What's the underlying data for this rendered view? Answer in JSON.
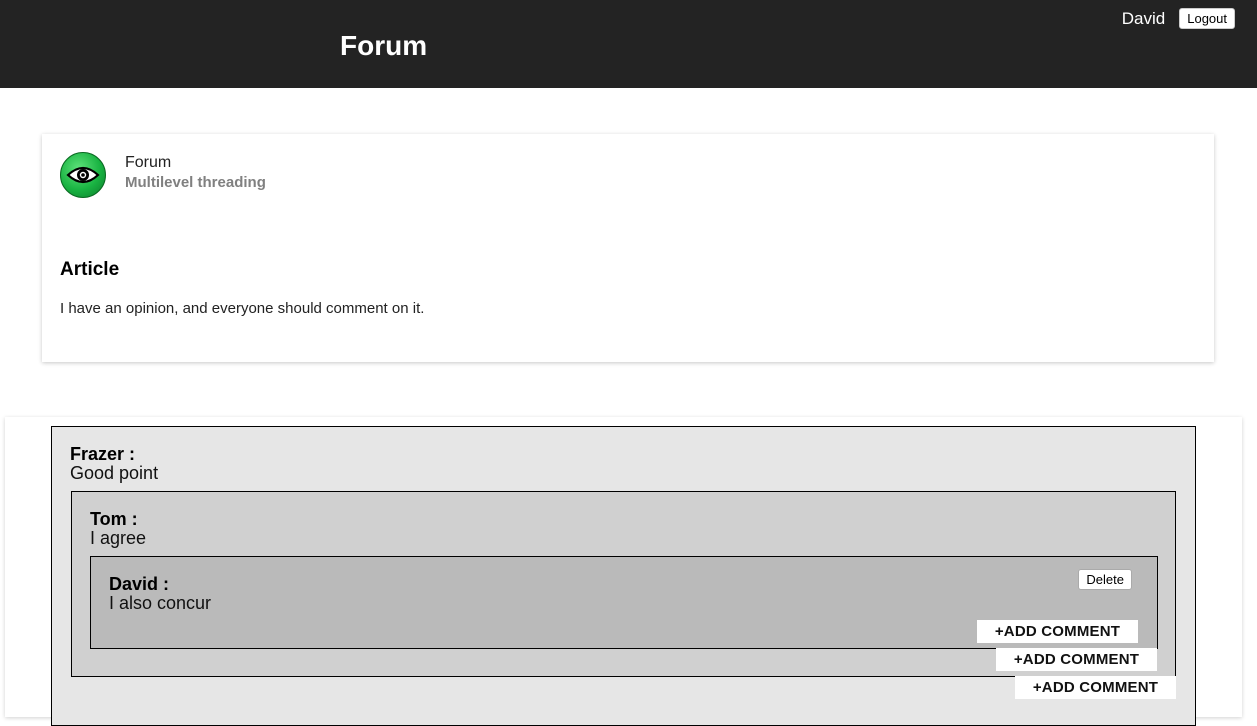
{
  "header": {
    "title": "Forum",
    "username": "David",
    "logout_label": "Logout"
  },
  "article": {
    "forum_name": "Forum",
    "forum_subtitle": "Multilevel threading",
    "heading": "Article",
    "body": "I have an opinion, and everyone should comment on it."
  },
  "comments": [
    {
      "author": "Frazer :",
      "text": "Good point",
      "add_label": "+ADD COMMENT",
      "replies": [
        {
          "author": "Tom :",
          "text": "I agree",
          "add_label": "+ADD COMMENT",
          "replies": [
            {
              "author": "David :",
              "text": "I also concur",
              "delete_label": "Delete",
              "add_label": "+ADD COMMENT"
            }
          ]
        }
      ]
    }
  ],
  "colors": {
    "header_bg": "#232323",
    "level1_bg": "#e6e6e6",
    "level2_bg": "#d0d0d0",
    "level3_bg": "#bababa",
    "avatar_green": "#19b342"
  }
}
